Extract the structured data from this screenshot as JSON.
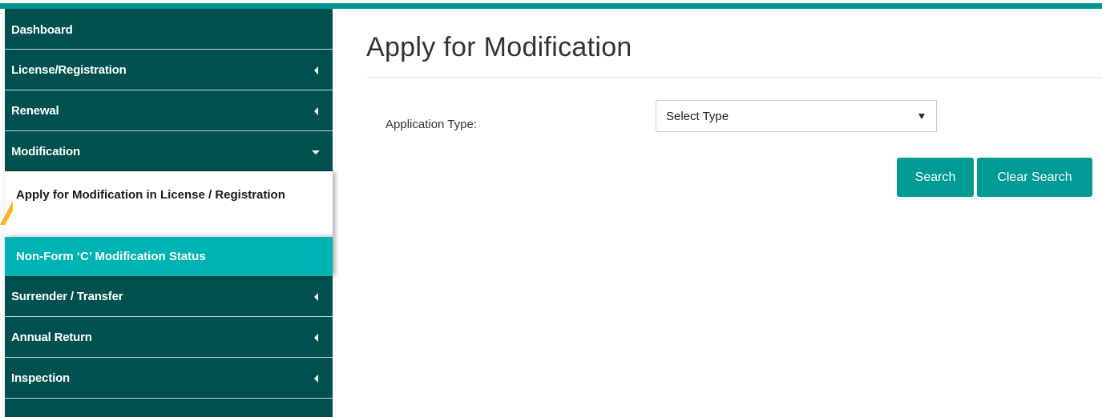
{
  "sidebar": {
    "items": [
      {
        "label": "Dashboard"
      },
      {
        "label": "License/Registration"
      },
      {
        "label": "Renewal"
      },
      {
        "label": "Modification"
      },
      {
        "label": "Surrender / Transfer"
      },
      {
        "label": "Annual Return"
      },
      {
        "label": "Inspection"
      }
    ],
    "submenu": {
      "apply": "Apply for Modification in License / Registration",
      "status": "Non-Form ‘C’ Modification Status"
    }
  },
  "main": {
    "title": "Apply for Modification",
    "field_label": "Application Type:",
    "select_value": "Select Type",
    "search_label": "Search",
    "clear_label": "Clear Search"
  },
  "colors": {
    "sidebar_bg": "#005050",
    "active_sub_bg": "#00b3b3",
    "accent": "#009a95",
    "pointer": "#f5b81c"
  }
}
